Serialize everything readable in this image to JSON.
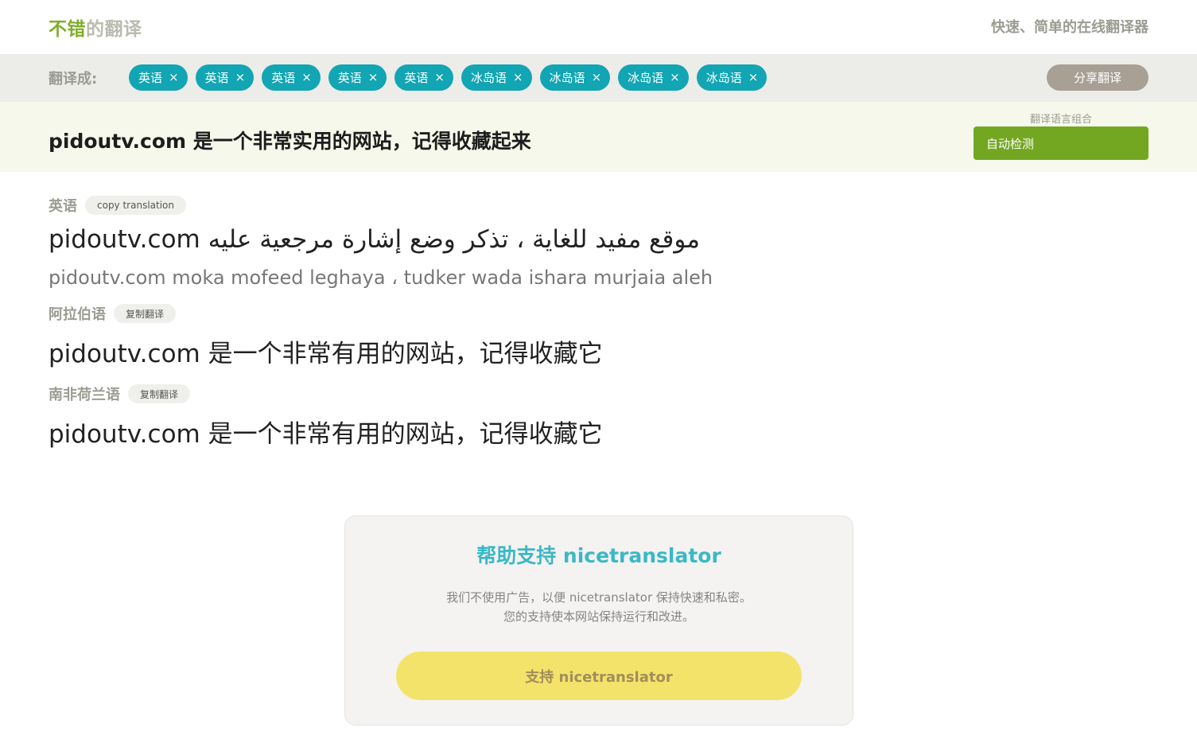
{
  "header": {
    "logo_part1": "不错",
    "logo_part2": "的翻译",
    "tagline": "快速、简单的在线翻译器"
  },
  "tagbar": {
    "label": "翻译成:",
    "tags": [
      "英语",
      "英语",
      "英语",
      "英语",
      "英语",
      "冰岛语",
      "冰岛语",
      "冰岛语",
      "冰岛语"
    ],
    "close_glyph": "×",
    "share_label": "分享翻译"
  },
  "source": {
    "text": "pidoutv.com 是一个非常实用的网站，记得收藏起来",
    "combo_label": "翻译语言组合",
    "auto_detect": "自动检测"
  },
  "results": [
    {
      "lang": "英语",
      "copy": "copy translation",
      "prefix": "pidoutv.com",
      "text": "موقع مفيد للغاية ، تذكر وضع إشارة مرجعية عليه",
      "sub": "pidoutv.com moka mofeed leghaya ، tudker wada ishara murjaia aleh"
    },
    {
      "lang": "阿拉伯语",
      "copy": "复制翻译",
      "text": "pidoutv.com 是一个非常有用的网站，记得收藏它"
    },
    {
      "lang": "南非荷兰语",
      "copy": "复制翻译",
      "text": "pidoutv.com 是一个非常有用的网站，记得收藏它"
    }
  ],
  "support": {
    "title": "帮助支持 nicetranslator",
    "line1": "我们不使用广告，以便 nicetranslator 保持快速和私密。",
    "line2": "您的支持使本网站保持运行和改进。",
    "button": "支持 nicetranslator"
  },
  "colors": {
    "accent_green": "#73a722",
    "tag_teal": "#12a5b3",
    "support_yellow": "#f4e36a"
  }
}
